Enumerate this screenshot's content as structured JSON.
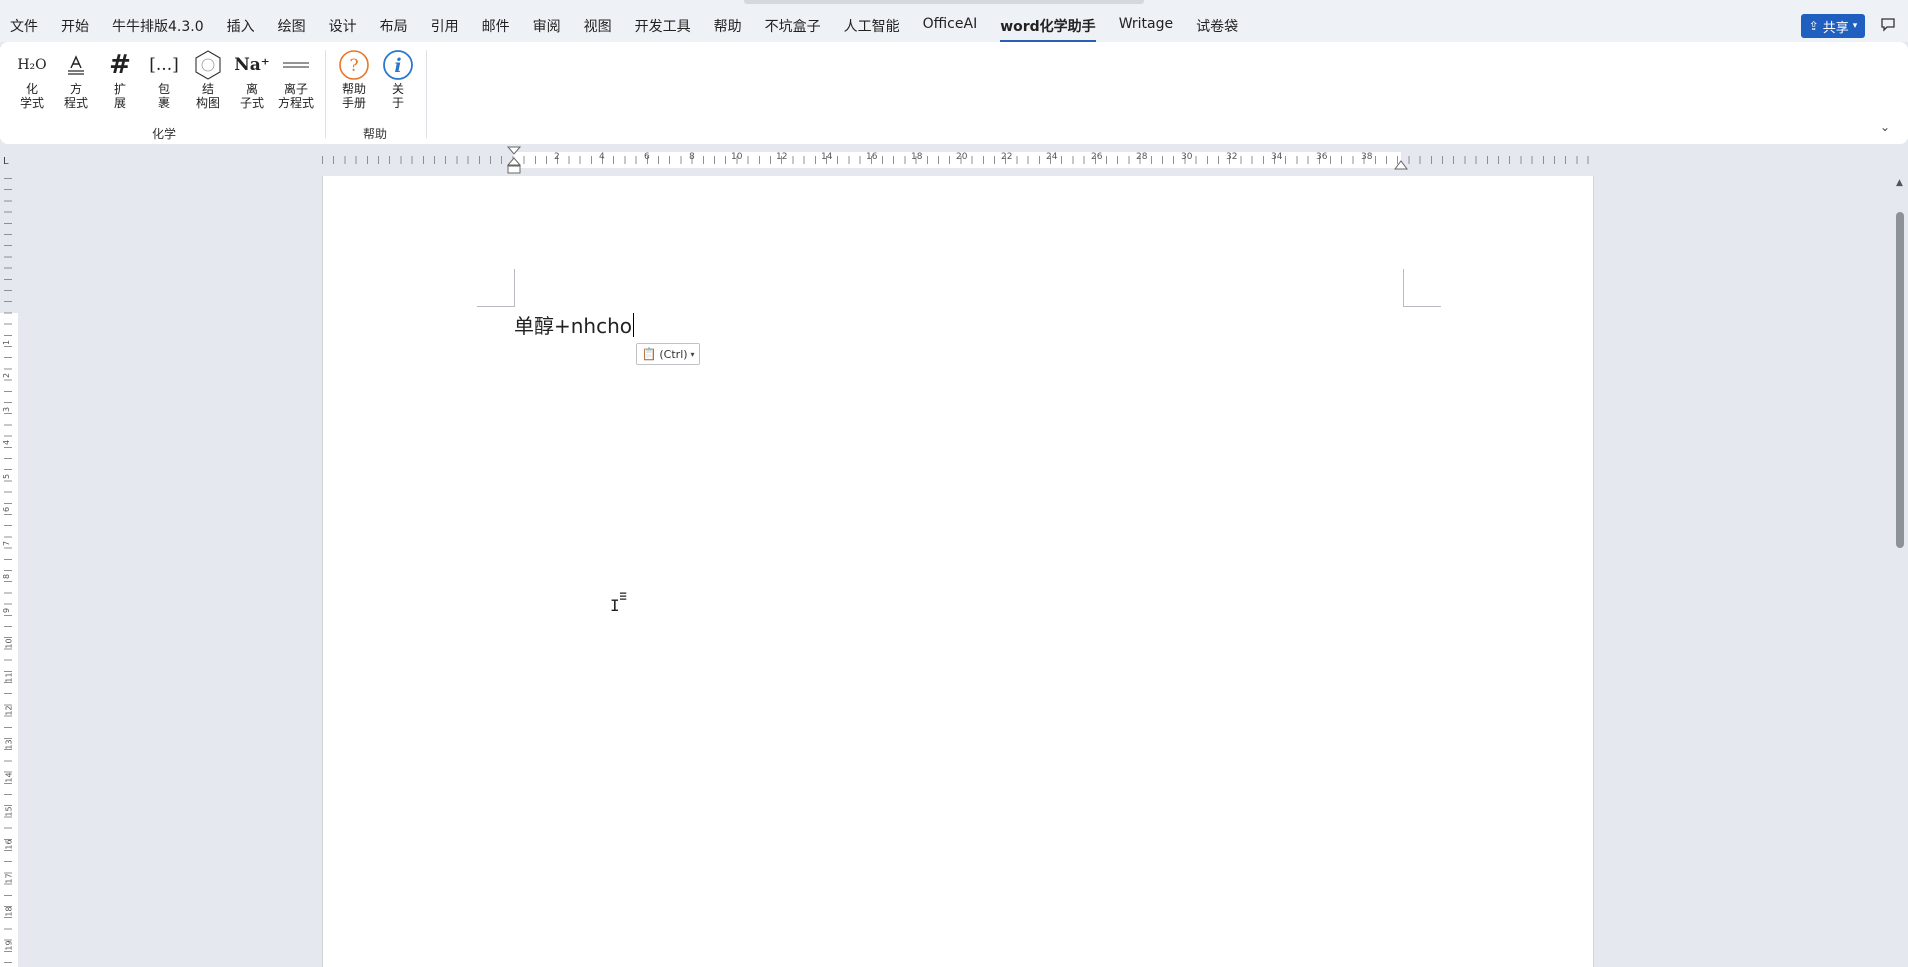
{
  "menubar": {
    "items": [
      {
        "label": "文件"
      },
      {
        "label": "开始"
      },
      {
        "label": "牛牛排版4.3.0"
      },
      {
        "label": "插入"
      },
      {
        "label": "绘图"
      },
      {
        "label": "设计"
      },
      {
        "label": "布局"
      },
      {
        "label": "引用"
      },
      {
        "label": "邮件"
      },
      {
        "label": "审阅"
      },
      {
        "label": "视图"
      },
      {
        "label": "开发工具"
      },
      {
        "label": "帮助"
      },
      {
        "label": "不坑盒子"
      },
      {
        "label": "人工智能"
      },
      {
        "label": "OfficeAI"
      },
      {
        "label": "word化学助手"
      },
      {
        "label": "Writage"
      },
      {
        "label": "试卷袋"
      }
    ],
    "active_index": 16,
    "share_label": "共享"
  },
  "ribbon": {
    "chemistry": {
      "group_label": "化学",
      "buttons": [
        {
          "name": "chemical-formula",
          "icon_text": "H₂O",
          "label": "化\n学式"
        },
        {
          "name": "equation",
          "icon_text": "A",
          "label": "方\n程式"
        },
        {
          "name": "extend",
          "icon_text": "#",
          "label": "扩\n展"
        },
        {
          "name": "wrap",
          "icon_text": "[...]",
          "label": "包\n裹"
        },
        {
          "name": "structure",
          "icon_text": "",
          "label": "结\n构图"
        },
        {
          "name": "ionic",
          "icon_text": "Na⁺",
          "label": "离\n子式"
        },
        {
          "name": "ionic-equation",
          "icon_text": "",
          "label": "离子\n方程式"
        }
      ]
    },
    "help": {
      "group_label": "帮助",
      "buttons": [
        {
          "name": "help-manual",
          "icon_text": "?",
          "label": "帮助\n手册"
        },
        {
          "name": "about",
          "icon_text": "i",
          "label": "关\n于"
        }
      ]
    }
  },
  "ruler": {
    "labels": [
      "2",
      "4",
      "6",
      "8",
      "10",
      "12",
      "14",
      "16",
      "18",
      "20",
      "22",
      "24",
      "26",
      "28",
      "30",
      "32",
      "34",
      "36",
      "38"
    ],
    "vertical_labels": [
      "1",
      "2",
      "3",
      "4",
      "5",
      "6",
      "7",
      "8",
      "9",
      "10",
      "11",
      "12",
      "13",
      "14",
      "15",
      "16",
      "17",
      "18",
      "19"
    ]
  },
  "document": {
    "text": "单醇+nhcho",
    "paste_options_label": "(Ctrl)"
  },
  "colors": {
    "accent": "#1f5fbf",
    "help_icon": "#e8762b",
    "about_icon": "#2b78c9"
  }
}
